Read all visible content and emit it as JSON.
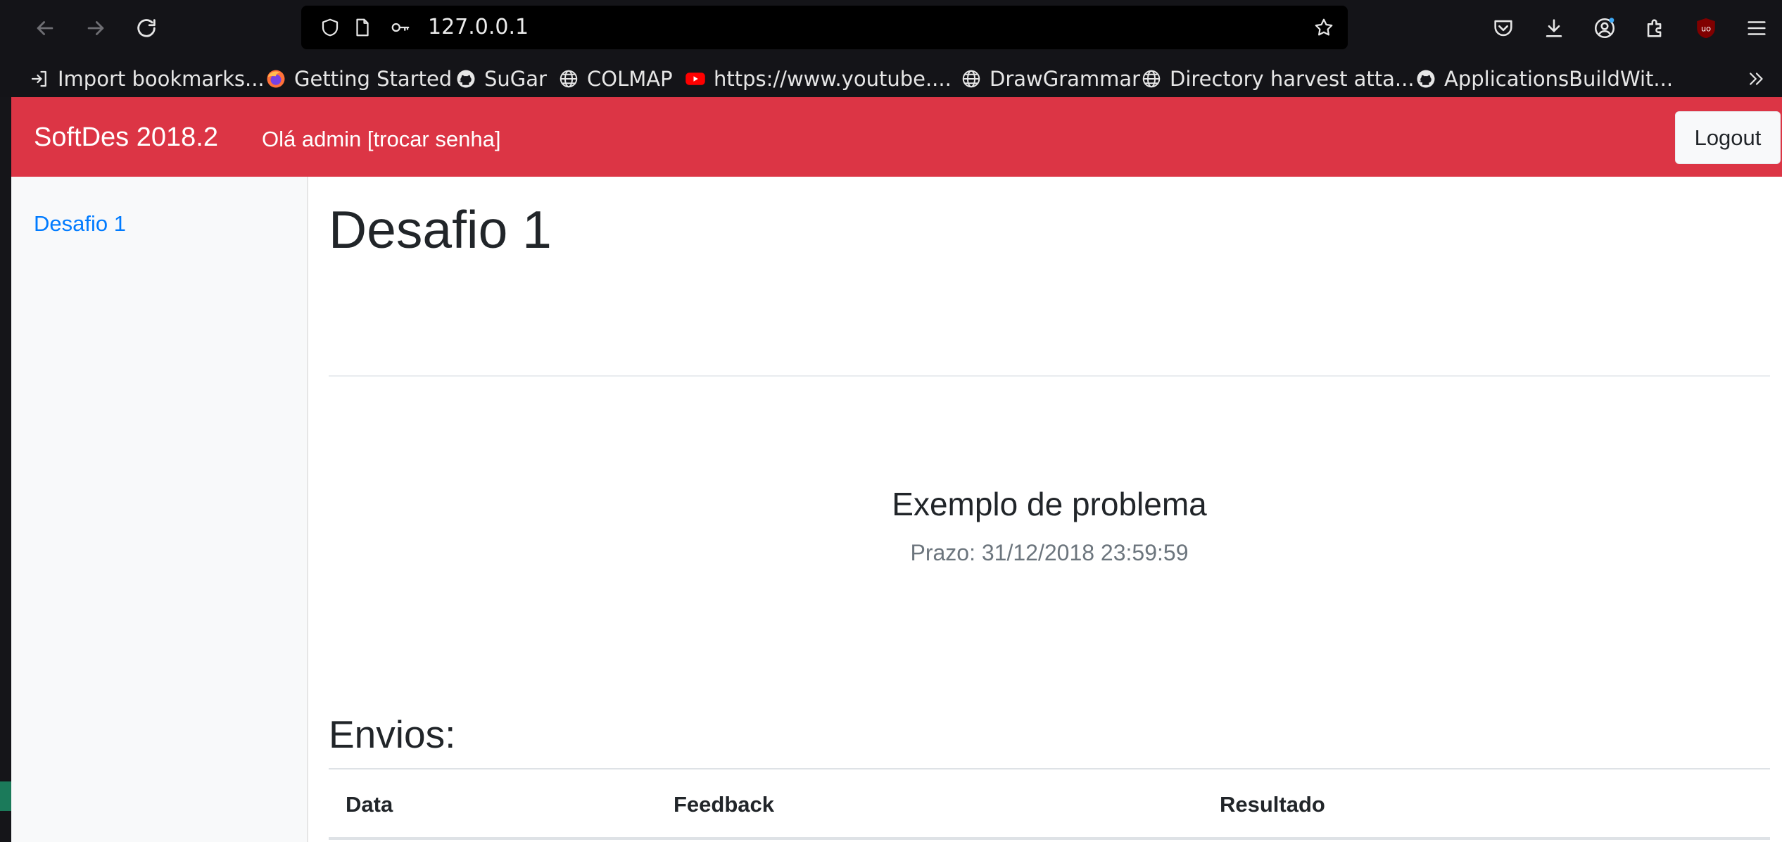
{
  "browser": {
    "url": "127.0.0.1",
    "bookmarks": [
      {
        "label": "Import bookmarks...",
        "icon": "import-icon"
      },
      {
        "label": "Getting Started",
        "icon": "firefox-icon"
      },
      {
        "label": "SuGar",
        "icon": "github-icon"
      },
      {
        "label": "COLMAP",
        "icon": "globe-icon"
      },
      {
        "label": "https://www.youtube....",
        "icon": "youtube-icon"
      },
      {
        "label": "DrawGrammar",
        "icon": "globe-icon"
      },
      {
        "label": "Directory harvest atta...",
        "icon": "globe-icon"
      },
      {
        "label": "ApplicationsBuildWit...",
        "icon": "github-icon"
      }
    ]
  },
  "navbar": {
    "brand": "SoftDes 2018.2",
    "greeting": "Olá admin [trocar senha]",
    "logout_label": "Logout",
    "color": "#dc3545"
  },
  "sidebar": {
    "items": [
      {
        "label": "Desafio 1"
      }
    ]
  },
  "main": {
    "title": "Desafio 1",
    "problem_title": "Exemplo de problema",
    "deadline": "Prazo: 31/12/2018 23:59:59",
    "envios_heading": "Envios:",
    "table": {
      "columns": [
        "Data",
        "Feedback",
        "Resultado"
      ],
      "rows": []
    }
  },
  "colors": {
    "link": "#007bff",
    "muted": "#6c757d",
    "sidebar_bg": "#f8f9fa"
  }
}
